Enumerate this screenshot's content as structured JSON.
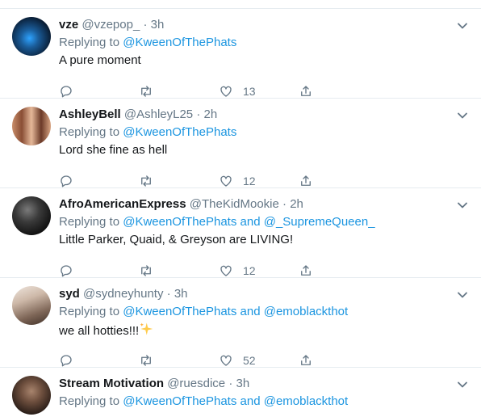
{
  "replying_prefix": "Replying to",
  "and_word": "and",
  "tweets": [
    {
      "name": "vze",
      "handle": "@vzepop_",
      "time": "3h",
      "mentions": [
        "@KweenOfThePhats"
      ],
      "text": "A pure moment",
      "likes": "13",
      "avatar_colors": [
        "#0c2a4a",
        "#3a8fd6"
      ]
    },
    {
      "name": "AshleyBell",
      "handle": "@AshleyL25",
      "time": "2h",
      "mentions": [
        "@KweenOfThePhats"
      ],
      "text": "Lord she fine as hell",
      "likes": "12",
      "avatar_colors": [
        "#b7795a",
        "#e3b595"
      ]
    },
    {
      "name": "AfroAmericanExpress",
      "handle": "@TheKidMookie",
      "time": "2h",
      "mentions": [
        "@KweenOfThePhats",
        "@_SupremeQueen_"
      ],
      "text": "Little Parker, Quaid, & Greyson are LIVING!",
      "likes": "12",
      "avatar_colors": [
        "#1b1b1b",
        "#6a6a6a"
      ]
    },
    {
      "name": "syd",
      "handle": "@sydneyhunty",
      "time": "3h",
      "mentions": [
        "@KweenOfThePhats",
        "@emoblackthot"
      ],
      "text": "we all hotties!!!",
      "emoji": "✨",
      "likes": "52",
      "avatar_colors": [
        "#8b7565",
        "#d9c8bb"
      ]
    },
    {
      "name": "Stream Motivation",
      "handle": "@ruesdice",
      "time": "3h",
      "mentions": [
        "@KweenOfThePhats",
        "@emoblackthot"
      ],
      "text": "",
      "likes": "",
      "avatar_colors": [
        "#3a2a22",
        "#9a7a66"
      ]
    }
  ]
}
